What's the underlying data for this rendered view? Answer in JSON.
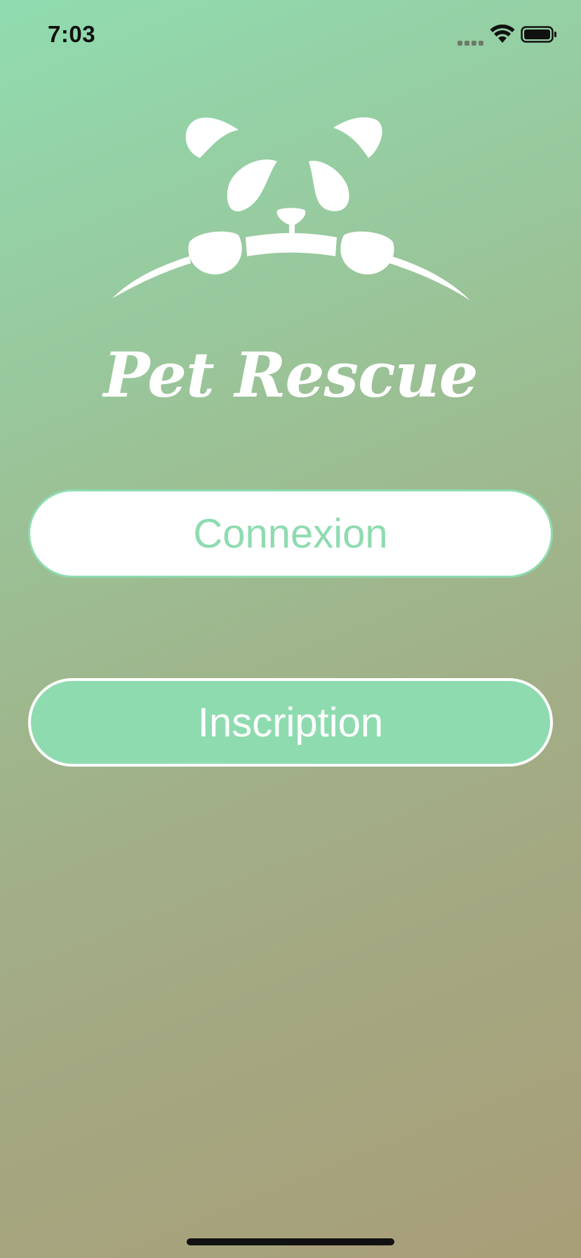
{
  "status_bar": {
    "time": "7:03",
    "icons": [
      "cellular-signal-icon",
      "wifi-icon",
      "battery-icon"
    ]
  },
  "logo": {
    "icon": "panda-logo-icon",
    "brand_name": "Pet Rescue"
  },
  "buttons": {
    "login_label": "Connexion",
    "signup_label": "Inscription"
  },
  "colors": {
    "accent": "#8fdbb0",
    "gradient_start": "#90dcb0",
    "gradient_end": "#a89e78",
    "white": "#ffffff"
  }
}
